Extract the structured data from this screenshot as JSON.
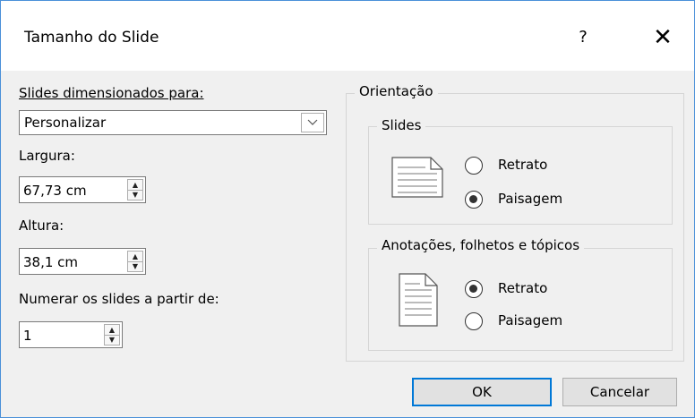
{
  "dialog": {
    "title": "Tamanho do Slide",
    "help_label": "?",
    "close_label": "✕"
  },
  "size": {
    "label": "Slides dimensionados para:",
    "selected": "Personalizar",
    "width_label": "Largura:",
    "width_value": "67,73 cm",
    "height_label": "Altura:",
    "height_value": "38,1 cm",
    "number_label": "Numerar os slides a partir de:",
    "number_value": "1"
  },
  "orientation": {
    "legend": "Orientação",
    "slides": {
      "legend": "Slides",
      "portrait_label": "Retrato",
      "landscape_label": "Paisagem",
      "selected": "Paisagem"
    },
    "notes": {
      "legend": "Anotações, folhetos e tópicos",
      "portrait_label": "Retrato",
      "landscape_label": "Paisagem",
      "selected": "Retrato"
    }
  },
  "buttons": {
    "ok": "OK",
    "cancel": "Cancelar"
  },
  "icons": {
    "landscape_page": "landscape-page-icon",
    "portrait_page": "portrait-page-icon",
    "dropdown": "chevron-down-icon",
    "spin": "spin-updown-icon"
  }
}
